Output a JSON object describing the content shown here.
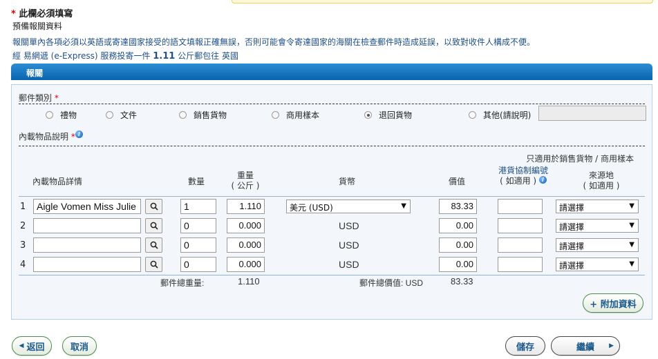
{
  "header": {
    "required_star": "*",
    "required_note": "此欄必須填寫",
    "prep_title": "預備報關資料",
    "notice": "報關單內各項必須以英語或寄達國家接受的語文填報正確無誤，否則可能會令寄達國家的海關在檢查郵件時造成延誤，以致對收件人構成不便。",
    "service_prefix": "經",
    "service_name": "易網遞 (e-Express)",
    "service_mid": "服務投寄一件",
    "service_weight": "1.11",
    "service_suffix": "公斤郵包往 英國"
  },
  "section_title": "報關",
  "category": {
    "label": "郵件類別",
    "star": "*",
    "options": [
      "禮物",
      "文件",
      "銷售貨物",
      "商用樣本",
      "退回貨物",
      "其他(請說明)"
    ],
    "selected_index": 4
  },
  "contents_label": "內載物品說明",
  "contents_star": "*",
  "table": {
    "note_top": "只適用於銷售貨物 / 商用樣本",
    "headers": {
      "details": "內載物品詳情",
      "quantity": "數量",
      "weight": "重量",
      "weight_unit": "( 公斤 )",
      "currency": "貨幣",
      "value": "價值",
      "hs_code": "港貨協制編號",
      "hs_sub": "( 如適用 )",
      "origin": "來源地",
      "origin_sub": "( 如適用 )"
    },
    "rows": [
      {
        "num": "1",
        "details": "Aigle Vomen Miss Julie",
        "qty": "1",
        "weight": "1.110",
        "currency": "美元 (USD)",
        "value": "83.33",
        "hs": "",
        "origin": "請選擇"
      },
      {
        "num": "2",
        "details": "",
        "qty": "0",
        "weight": "0.000",
        "currency": "USD",
        "value": "0.00",
        "hs": "",
        "origin": "請選擇"
      },
      {
        "num": "3",
        "details": "",
        "qty": "0",
        "weight": "0.000",
        "currency": "USD",
        "value": "0.00",
        "hs": "",
        "origin": "請選擇"
      },
      {
        "num": "4",
        "details": "",
        "qty": "0",
        "weight": "0.000",
        "currency": "USD",
        "value": "0.00",
        "hs": "",
        "origin": "請選擇"
      }
    ],
    "totals": {
      "weight_label": "郵件總重量:",
      "weight_value": "1.110",
      "value_label": "郵件總價值: USD",
      "value_value": "83.33"
    }
  },
  "buttons": {
    "add_info": "+ 附加資料",
    "back": "返回",
    "cancel": "取消",
    "save": "儲存",
    "continue": "繼續"
  },
  "colors": {
    "accent_blue": "#0a63ae",
    "required_red": "#dd0000",
    "button_border_green": "#4a8a4a"
  }
}
